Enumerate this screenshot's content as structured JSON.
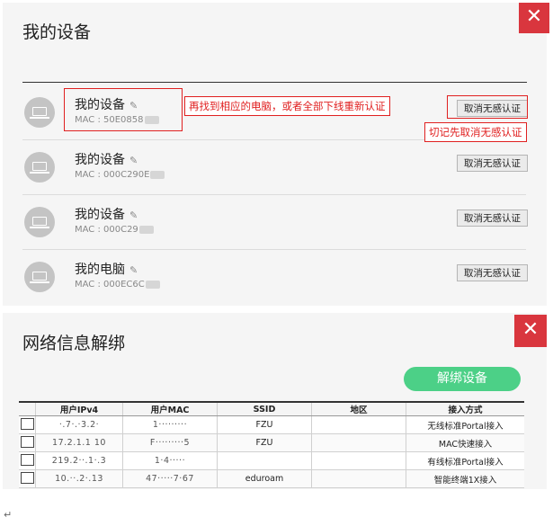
{
  "devices_panel": {
    "title": "我的设备",
    "close_label": "✕",
    "devices": [
      {
        "name": "我的设备",
        "mac": "MAC : 50E0858",
        "cancel_label": "取消无感认证"
      },
      {
        "name": "我的设备",
        "mac": "MAC : 000C290E",
        "cancel_label": "取消无感认证"
      },
      {
        "name": "我的设备",
        "mac": "MAC : 000C29",
        "cancel_label": "取消无感认证"
      },
      {
        "name": "我的电脑",
        "mac": "MAC : 000EC6C",
        "cancel_label": "取消无感认证"
      }
    ],
    "icons": {
      "device": "laptop-icon",
      "edit": "pencil-icon",
      "close": "close-icon"
    }
  },
  "annotations": {
    "find_pc": "再找到相应的电脑，或者全部下线重新认证",
    "remember": "切记先取消无感认证"
  },
  "unbind_panel": {
    "title": "网络信息解绑",
    "close_label": "✕",
    "unbind_button": "解绑设备",
    "columns": [
      "",
      "用户IPv4",
      "用户MAC",
      "SSID",
      "地区",
      "接入方式"
    ],
    "rows": [
      {
        "ipv4": "·.7·.·3.2·",
        "mac": "1·········",
        "ssid": "FZU",
        "region": "",
        "access": "无线标准Portal接入"
      },
      {
        "ipv4": "17.2.1.1 10",
        "mac": "F·········5",
        "ssid": "FZU",
        "region": "",
        "access": "MAC快速接入"
      },
      {
        "ipv4": "219.2··.1·.3",
        "mac": "1·4·····",
        "ssid": "",
        "region": "",
        "access": "有线标准Portal接入"
      },
      {
        "ipv4": "10.··.2·.13",
        "mac": "47·····7·67",
        "ssid": "eduroam",
        "region": "",
        "access": "智能终端1X接入"
      }
    ]
  },
  "footer_mark": "↵",
  "colors": {
    "close_bg": "#d9363e",
    "unbind_bg": "#4cd087",
    "annotation": "#e02020"
  }
}
